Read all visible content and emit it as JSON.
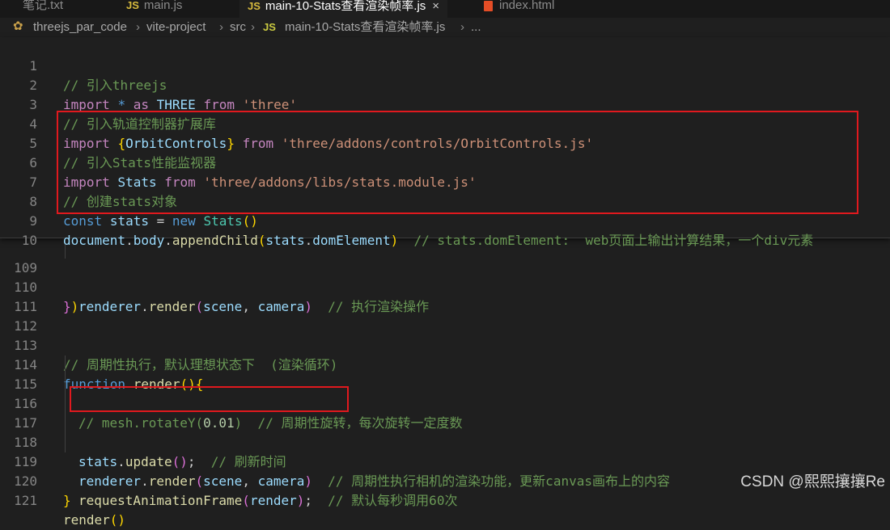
{
  "tabs": [
    {
      "label": "笔记.txt"
    },
    {
      "label": "main.js",
      "icon": "JS"
    },
    {
      "label": "main-10-Stats查看渲染帧率.js",
      "icon": "JS",
      "close": "×"
    },
    {
      "label": "index.html"
    }
  ],
  "breadcrumb": {
    "items": [
      "threejs_par_code",
      "vite-project",
      "src"
    ],
    "file_icon": "JS",
    "file": "main-10-Stats查看渲染帧率.js",
    "ellipsis": "...",
    "separator": "›"
  },
  "sticky_lines": [
    {
      "n": "1",
      "c": "// 引入threejs"
    },
    {
      "n": "2",
      "kw": "import",
      "star": "*",
      "as": "as",
      "ns": "THREE",
      "from": "from",
      "str": "'three'"
    },
    {
      "n": "3",
      "c": "// 引入轨道控制器扩展库"
    },
    {
      "n": "4",
      "kw": "import",
      "ob": "{",
      "name": "OrbitControls",
      "cb": "}",
      "from": "from",
      "str": "'three/addons/controls/OrbitControls.js'"
    },
    {
      "n": "5",
      "c": "// 引入Stats性能监视器"
    },
    {
      "n": "6",
      "kw": "import",
      "name": "Stats",
      "from": "from",
      "str": "'three/addons/libs/stats.module.js'"
    },
    {
      "n": "7",
      "c": "// 创建stats对象"
    },
    {
      "n": "8",
      "kw": "const",
      "var": "stats",
      "eq": "=",
      "new": "new",
      "cls": "Stats",
      "parens": "()"
    },
    {
      "n": "9",
      "a": "document",
      "b": "body",
      "fn": "appendChild",
      "var": "stats",
      "prop": "domElement",
      "c": "// stats.domElement:  web页面上输出计算结果，一个div元素"
    },
    {
      "n": "10"
    }
  ],
  "lines": [
    {
      "n": "109",
      "obj": "renderer",
      "fn": "render",
      "arg1": "scene",
      "arg2": "camera",
      "c": "// 执行渲染操作"
    },
    {
      "n": "110",
      "brace": "}",
      "paren": ")"
    },
    {
      "n": "111"
    },
    {
      "n": "112"
    },
    {
      "n": "113",
      "c": "// 周期性执行，默认理想状态下  (渲染循环)"
    },
    {
      "n": "114",
      "kw": "function",
      "fn": "render",
      "open": "(){"
    },
    {
      "n": "115",
      "c1": "// mesh.rotateY(",
      "num": "0.01",
      "c2": ")  // 周期性旋转，每次旋转一定度数"
    },
    {
      "n": "116"
    },
    {
      "n": "117",
      "var": "stats",
      "fn": "update",
      "parens": "()",
      "semi": ";",
      "c": "// 刷新时间"
    },
    {
      "n": "118",
      "obj": "renderer",
      "fn": "render",
      "arg1": "scene",
      "arg2": "camera",
      "c": "// 周期性执行相机的渲染功能，更新canvas画布上的内容"
    },
    {
      "n": "119",
      "fn": "requestAnimationFrame",
      "arg": "render",
      "c": "// 默认每秒调用60次"
    },
    {
      "n": "120",
      "brace": "}"
    },
    {
      "n": "121",
      "fn": "render",
      "parens": "()"
    }
  ],
  "watermark": "CSDN @熙熙攘攘Re",
  "colors": {
    "highlight_box": "#e0191e",
    "comment": "#6a9955",
    "keyword": "#c586c0",
    "string": "#ce9178"
  }
}
